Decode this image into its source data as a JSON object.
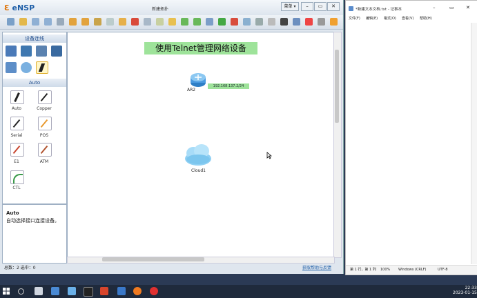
{
  "ensp": {
    "logo_prefix": "Ɛ",
    "logo_text": "eNSP",
    "window_title": "新建拓扑",
    "menu_label": "菜单 ▾",
    "minimize": "–",
    "restore": "▭",
    "close": "✕",
    "device_panel_title": "设备连线",
    "cable_section_title": "Auto",
    "cables": [
      {
        "label": "Auto"
      },
      {
        "label": "Copper"
      },
      {
        "label": "Serial"
      },
      {
        "label": "POS"
      },
      {
        "label": "E1"
      },
      {
        "label": "ATM"
      },
      {
        "label": "CTL"
      }
    ],
    "info_title": "Auto",
    "info_desc": "自动选择接口连接设备。",
    "banner": "使用Telnet管理网络设备",
    "router_label": "AR2",
    "router_ip": "192.168.137.2/24",
    "cloud_label": "Cloud1",
    "status_left": "总数：2  选中：0",
    "status_right": "获取帮助与反馈"
  },
  "notepad": {
    "title": "*新建文本文档.txt - 记事本",
    "menu": [
      "文件(F)",
      "编辑(E)",
      "格式(O)",
      "查看(V)",
      "帮助(H)"
    ],
    "status": {
      "position": "第 1 行，第 1 列",
      "zoom": "100%",
      "eol": "Windows (CRLF)",
      "encoding": "UTF-8"
    }
  },
  "taskbar": {
    "time": "22:33",
    "date": "2023-01-15"
  },
  "colors": {
    "banner_bg": "#9ee39a",
    "accent": "#1f5fa8",
    "taskbar": "#1f2a3c"
  }
}
